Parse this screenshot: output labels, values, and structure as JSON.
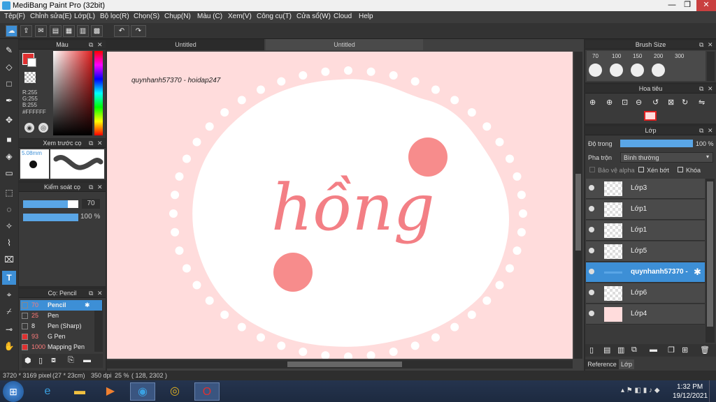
{
  "window": {
    "title": "MediBang Paint Pro (32bit)",
    "min": "—",
    "max": "❐",
    "close": "✕"
  },
  "menu": [
    "Tệp(F)",
    "Chỉnh sửa(E)",
    "Lớp(L)",
    "Bộ lọc(R)",
    "Chọn(S)",
    "Chụp(N)",
    "Màu (C)",
    "Xem(V)",
    "Công cụ(T)",
    "Cửa sổ(W)",
    "Cloud",
    "Help"
  ],
  "tabs": [
    "Untitled",
    "Untitled"
  ],
  "color_panel": {
    "title": "Màu",
    "r": "R:255",
    "g": "G:255",
    "b": "B:255",
    "hex": "#FFFFFF"
  },
  "brush_preview": {
    "title": "Xem trước cọ",
    "size": "5.08mm"
  },
  "brush_control": {
    "title": "Kiểm soát cọ",
    "size_value": "70",
    "opacity_value": "100 %"
  },
  "brush_list": {
    "title": "Cọ: Pencil",
    "items": [
      {
        "size": "70",
        "name": "Pencil",
        "color": "#2e2e2e",
        "selected": true
      },
      {
        "size": "25",
        "name": "Pen",
        "color": "#2e2e2e"
      },
      {
        "size": "8",
        "name": "Pen (Sharp)",
        "color": "#2e2e2e"
      },
      {
        "size": "93",
        "name": "G Pen",
        "color": "#e03030"
      },
      {
        "size": "1000",
        "name": "Mapping Pen",
        "color": "#e03030"
      }
    ]
  },
  "canvas": {
    "watermark": "quynhanh57370 - hoidap247",
    "art_text": "hồng"
  },
  "brush_size_panel": {
    "title": "Brush Size",
    "sizes": [
      "70",
      "100",
      "150",
      "200",
      "300"
    ]
  },
  "navigator": {
    "title": "Hoa tiêu"
  },
  "layer_panel": {
    "title": "Lớp",
    "opacity_label": "Độ trong",
    "opacity_value": "100 %",
    "opacity_fraction": 1.0,
    "blend_label": "Pha trộn",
    "blend_value": "Bình thường",
    "protect_alpha": "Bảo vệ alpha",
    "clipping": "Xén bớt",
    "lock": "Khóa",
    "layers": [
      {
        "name": "Lớp3"
      },
      {
        "name": "Lớp1"
      },
      {
        "name": "Lớp1"
      },
      {
        "name": "Lớp5"
      },
      {
        "name": "quynhanh57370 -",
        "selected": true
      },
      {
        "name": "Lớp6"
      },
      {
        "name": "Lớp4"
      }
    ],
    "bottom_tabs": [
      "Reference",
      "Lớp"
    ]
  },
  "status": {
    "size": "3720 * 3169 pixel",
    "cm": "(27 * 23cm)",
    "dpi": "350 dpi",
    "zoom": "25 %",
    "coords": "( 128, 2302 )"
  },
  "taskbar": {
    "time": "1:32 PM",
    "date": "19/12/2021"
  },
  "colors": {
    "accent": "#3d8fd6",
    "canvas_bg": "#ffdcdc",
    "dots": "#ffffff",
    "circles": "#f78c8c"
  }
}
